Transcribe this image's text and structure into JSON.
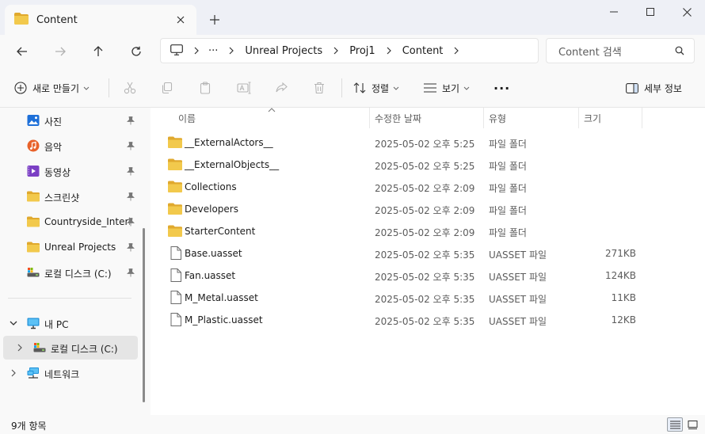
{
  "window": {
    "tab_title": "Content",
    "new_tab": "+"
  },
  "navigation": {
    "breadcrumbs": [
      "Unreal Projects",
      "Proj1",
      "Content"
    ],
    "ellipsis": "···",
    "search_placeholder": "Content 검색"
  },
  "toolbar": {
    "new_label": "새로 만들기",
    "sort_label": "정렬",
    "view_label": "보기",
    "more_label": "···",
    "details_label": "세부 정보"
  },
  "sidebar": {
    "quick_access": [
      {
        "label": "사진",
        "icon": "photos-icon",
        "color": "#1d6fd8"
      },
      {
        "label": "음악",
        "icon": "music-icon",
        "color": "#e8622a"
      },
      {
        "label": "동영상",
        "icon": "video-icon",
        "color": "#7b3fc4"
      },
      {
        "label": "스크린샷",
        "icon": "folder-icon",
        "color": "#f2c94c"
      },
      {
        "label": "Countryside_Interior",
        "icon": "folder-icon",
        "color": "#f2c94c"
      },
      {
        "label": "Unreal Projects",
        "icon": "folder-icon",
        "color": "#f2c94c"
      },
      {
        "label": "로컬 디스크 (C:)",
        "icon": "drive-icon",
        "color": "#4a4a4a"
      }
    ],
    "this_pc": "내 PC",
    "local_disk": "로컬 디스크 (C:)",
    "network": "네트워크"
  },
  "columns": {
    "name": "이름",
    "date": "수정한 날짜",
    "type": "유형",
    "size": "크기"
  },
  "files": [
    {
      "name": "__ExternalActors__",
      "date": "2025-05-02 오후 5:25",
      "type": "파일 폴더",
      "size": "",
      "kind": "folder"
    },
    {
      "name": "__ExternalObjects__",
      "date": "2025-05-02 오후 5:25",
      "type": "파일 폴더",
      "size": "",
      "kind": "folder"
    },
    {
      "name": "Collections",
      "date": "2025-05-02 오후 2:09",
      "type": "파일 폴더",
      "size": "",
      "kind": "folder"
    },
    {
      "name": "Developers",
      "date": "2025-05-02 오후 2:09",
      "type": "파일 폴더",
      "size": "",
      "kind": "folder"
    },
    {
      "name": "StarterContent",
      "date": "2025-05-02 오후 2:09",
      "type": "파일 폴더",
      "size": "",
      "kind": "folder"
    },
    {
      "name": "Base.uasset",
      "date": "2025-05-02 오후 5:35",
      "type": "UASSET 파일",
      "size": "271KB",
      "kind": "file"
    },
    {
      "name": "Fan.uasset",
      "date": "2025-05-02 오후 5:35",
      "type": "UASSET 파일",
      "size": "124KB",
      "kind": "file"
    },
    {
      "name": "M_Metal.uasset",
      "date": "2025-05-02 오후 5:35",
      "type": "UASSET 파일",
      "size": "11KB",
      "kind": "file"
    },
    {
      "name": "M_Plastic.uasset",
      "date": "2025-05-02 오후 5:35",
      "type": "UASSET 파일",
      "size": "12KB",
      "kind": "file"
    }
  ],
  "status": {
    "item_count": "9개 항목"
  },
  "colors": {
    "folder": "#f2c94c",
    "folder_dark": "#e0a92e",
    "accent": "#0067c0"
  }
}
